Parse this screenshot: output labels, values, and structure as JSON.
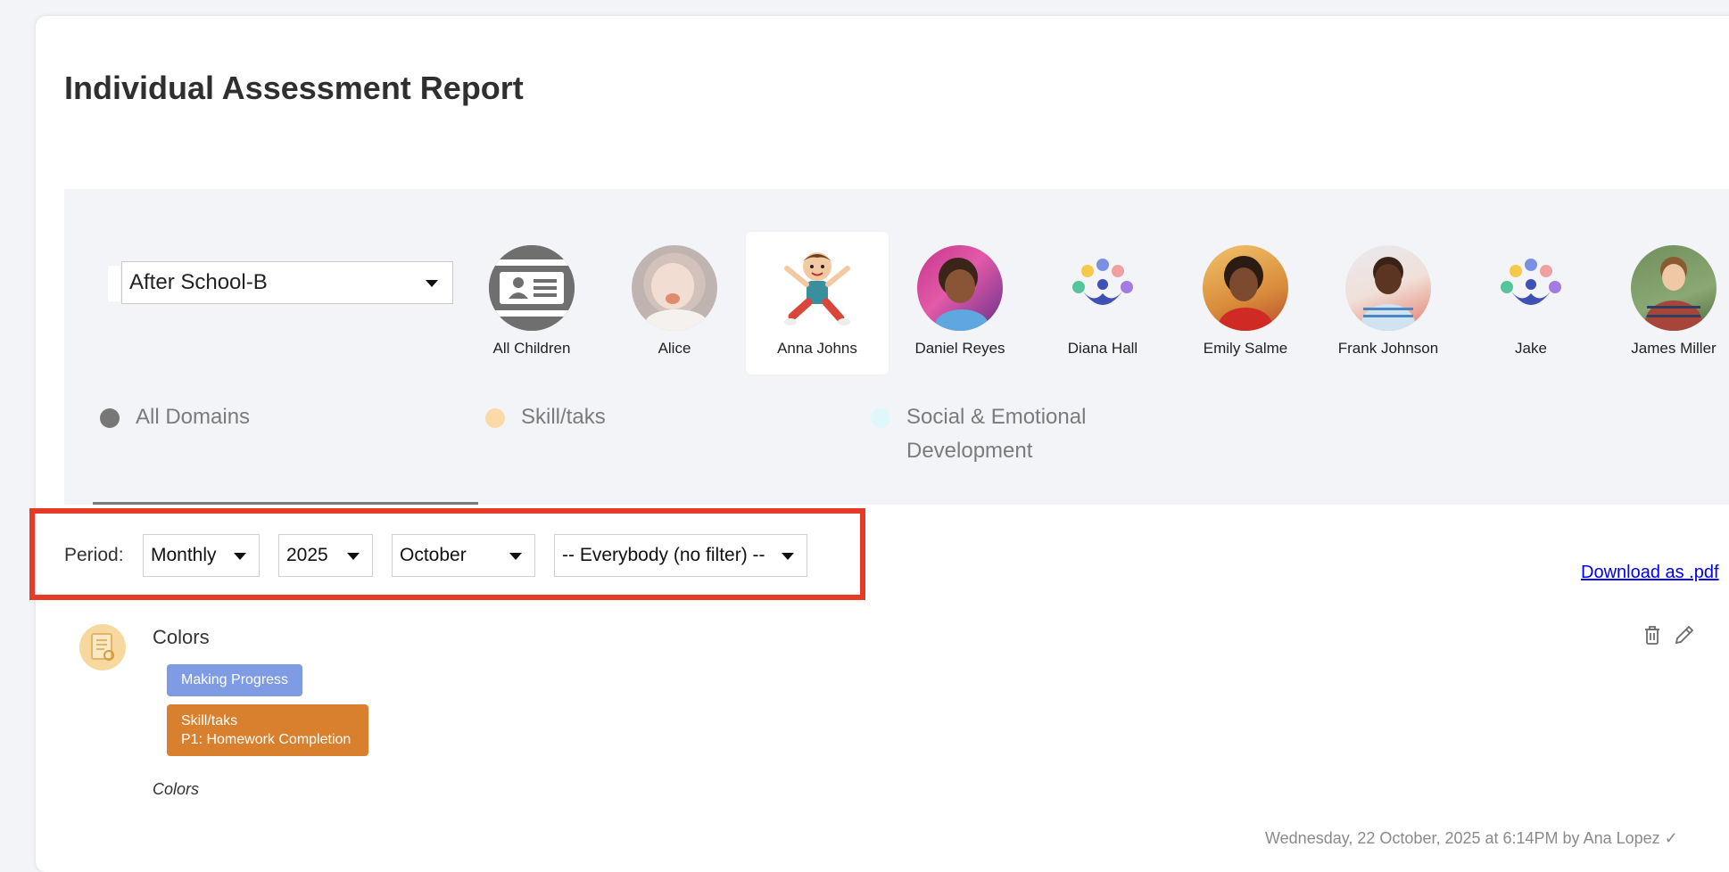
{
  "page": {
    "title": "Individual Assessment Report"
  },
  "group_select": {
    "value": "After School-B"
  },
  "children": [
    {
      "name": "All Children",
      "avatar": "id-card-icon"
    },
    {
      "name": "Alice",
      "avatar": "baby-photo"
    },
    {
      "name": "Anna Johns",
      "avatar": "cartoon-boy",
      "selected": true
    },
    {
      "name": "Daniel Reyes",
      "avatar": "child-photo"
    },
    {
      "name": "Diana Hall",
      "avatar": "people-logo-icon"
    },
    {
      "name": "Emily Salme",
      "avatar": "child-photo"
    },
    {
      "name": "Frank Johnson",
      "avatar": "child-photo"
    },
    {
      "name": "Jake",
      "avatar": "people-logo-icon"
    },
    {
      "name": "James Miller",
      "avatar": "child-photo"
    }
  ],
  "domains": [
    {
      "label": "All Domains",
      "color": "#777777",
      "active": true
    },
    {
      "label": "Skill/taks",
      "color": "#fbd9a8"
    },
    {
      "label_line1": "Social & Emotional",
      "label_line2": "Development",
      "color": "#dff7fb"
    }
  ],
  "period": {
    "label": "Period:",
    "frequency": "Monthly",
    "year": "2025",
    "month": "October",
    "filter": "-- Everybody (no filter) --"
  },
  "download_label": "Download as .pdf",
  "entry": {
    "title": "Colors",
    "progress_tag": "Making Progress",
    "skill_tag_line1": "Skill/taks",
    "skill_tag_line2": "P1: Homework Completion",
    "note": "Colors",
    "meta": "Wednesday, 22 October, 2025 at 6:14PM by Ana Lopez"
  },
  "colors": {
    "highlight": "#e53a26",
    "progress": "#7e9be3",
    "skill": "#d9802e"
  }
}
